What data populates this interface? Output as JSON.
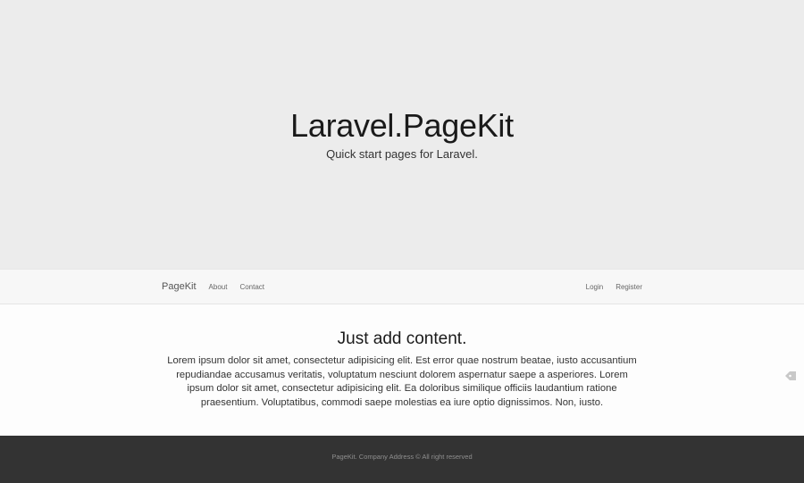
{
  "hero": {
    "title": "Laravel.PageKit",
    "subtitle": "Quick start pages for Laravel."
  },
  "navbar": {
    "brand": "PageKit",
    "links_left": [
      "About",
      "Contact"
    ],
    "links_right": [
      "Login",
      "Register"
    ]
  },
  "content": {
    "heading": "Just add content.",
    "body": "Lorem ipsum dolor sit amet, consectetur adipisicing elit. Est error quae nostrum beatae, iusto accusantium repudiandae accusamus veritatis, voluptatum nesciunt dolorem aspernatur saepe a asperiores. Lorem ipsum dolor sit amet, consectetur adipisicing elit. Ea doloribus similique officiis laudantium ratione praesentium. Voluptatibus, commodi saepe molestias ea iure optio dignissimos. Non, iusto."
  },
  "side_icon": "tag-icon",
  "footer": {
    "text": "PageKit. Company Address © All right reserved"
  },
  "colors": {
    "hero_bg": "#ececec",
    "navbar_bg": "#f7f7f7",
    "footer_bg": "#333333"
  }
}
